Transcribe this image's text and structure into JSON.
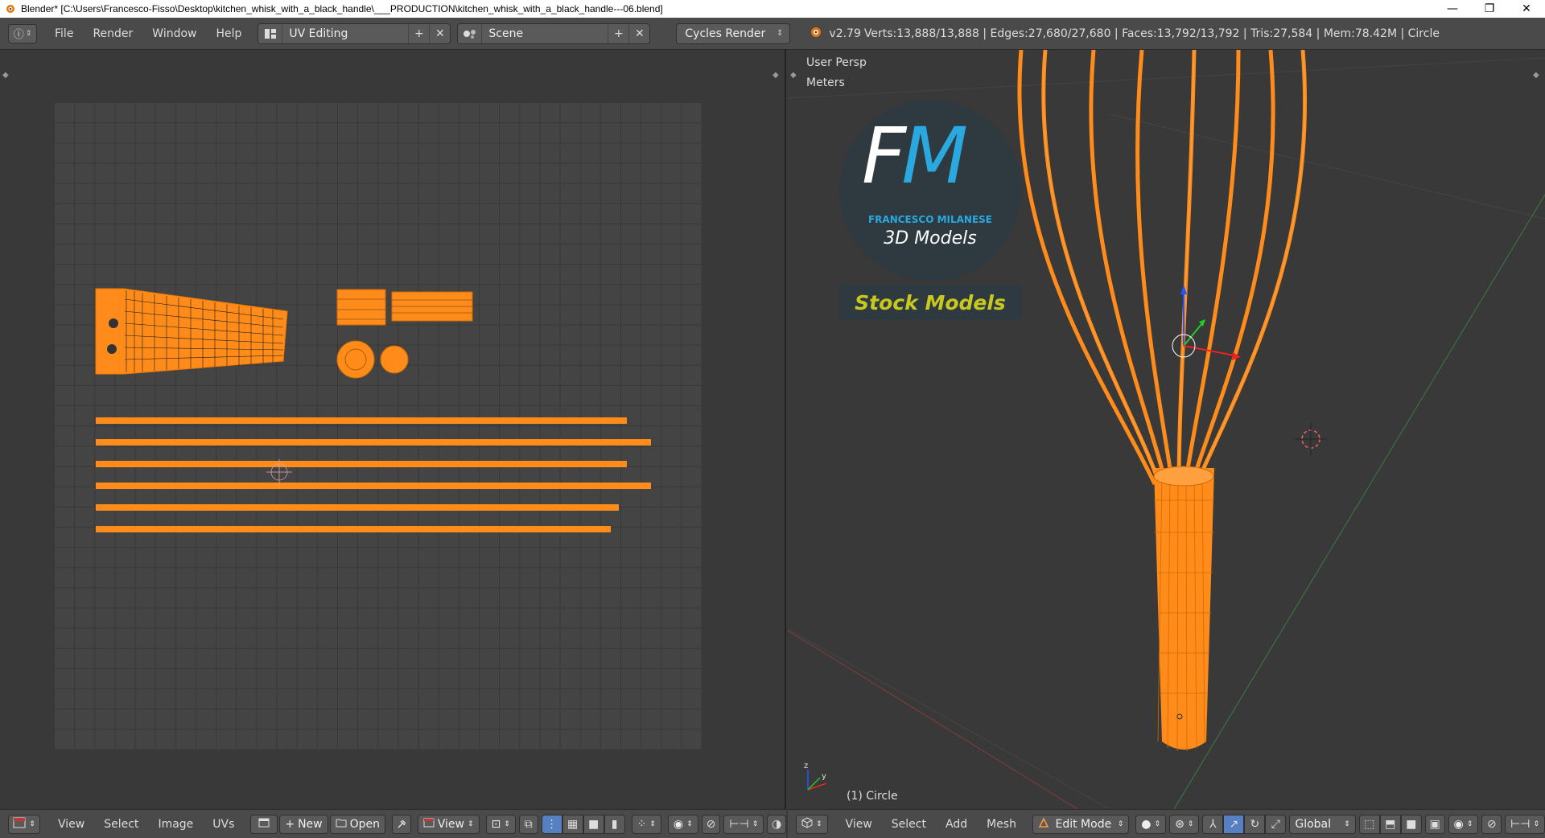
{
  "window": {
    "title": "Blender* [C:\\Users\\Francesco-Fisso\\Desktop\\kitchen_whisk_with_a_black_handle\\___PRODUCTION\\kitchen_whisk_with_a_black_handle---06.blend]",
    "minimize": "—",
    "maximize": "❐",
    "close": "✕"
  },
  "infobar": {
    "menus": [
      "File",
      "Render",
      "Window",
      "Help"
    ],
    "screen_layout": "UV Editing",
    "scene": "Scene",
    "render_engine": "Cycles Render",
    "version": "v2.79",
    "stats": "Verts:13,888/13,888 | Edges:27,680/27,680 | Faces:13,792/13,792 | Tris:27,584 | Mem:78.42M | Circle"
  },
  "uv_editor": {
    "menus": [
      "View",
      "Select",
      "Image",
      "UVs"
    ],
    "new_label": "New",
    "open_label": "Open",
    "view_label": "View"
  },
  "viewport": {
    "view_name": "User Persp",
    "units": "Meters",
    "object_label": "(1) Circle",
    "menus": [
      "View",
      "Select",
      "Add",
      "Mesh"
    ],
    "mode": "Edit Mode",
    "orientation": "Global",
    "logo": {
      "initials_f": "F",
      "initials_m": "M",
      "brand": "FRANCESCO MILANESE",
      "tagline": "3D Models",
      "banner": "Stock Models"
    }
  },
  "colors": {
    "mesh_orange": "#ff8c1a",
    "logo_blue": "#29a9e0",
    "banner_yellow": "#c8c81e"
  }
}
